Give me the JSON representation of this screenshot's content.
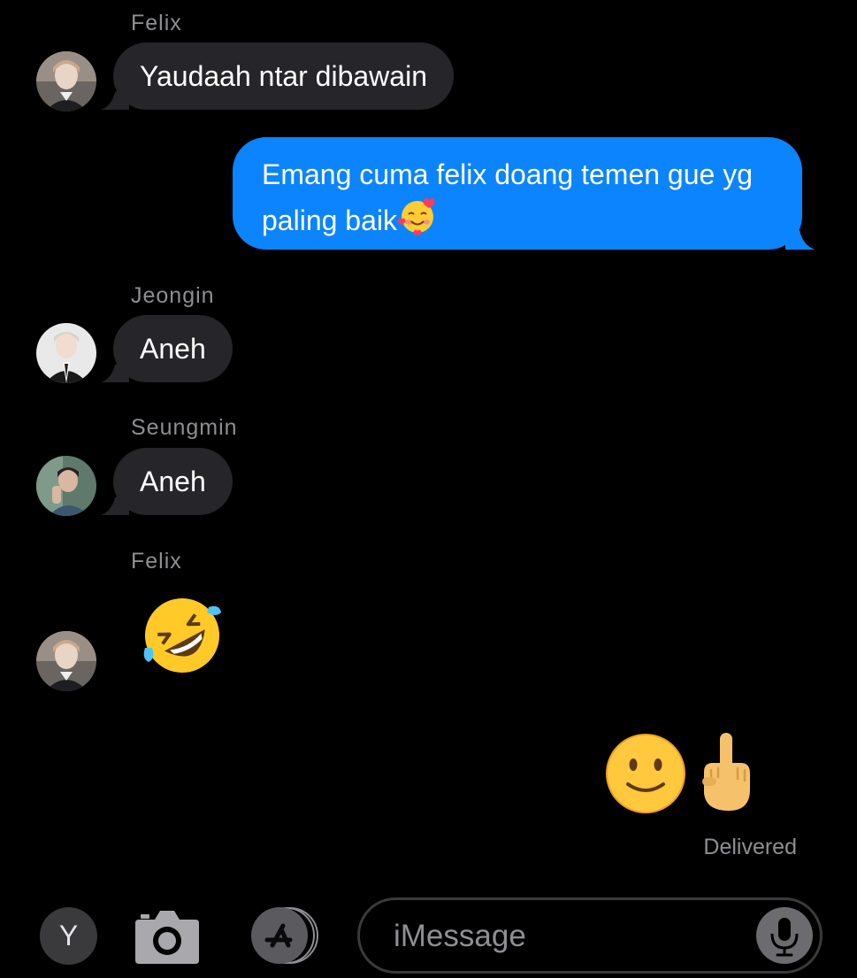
{
  "messages": [
    {
      "type": "incoming",
      "sender": "Felix",
      "text": "Yaudaah ntar dibawain"
    },
    {
      "type": "outgoing",
      "line1": "Emang cuma felix doang temen gue yg",
      "line2": "paling baik",
      "emoji": "smiling-face-with-hearts"
    },
    {
      "type": "incoming",
      "sender": "Jeongin",
      "text": "Aneh"
    },
    {
      "type": "incoming",
      "sender": "Seungmin",
      "text": "Aneh"
    },
    {
      "type": "incoming",
      "sender": "Felix",
      "emoji": "rolling-on-floor-laughing"
    },
    {
      "type": "outgoing",
      "emojis": [
        "slightly-smiling-face",
        "middle-finger"
      ]
    }
  ],
  "status": {
    "delivered": "Delivered"
  },
  "compose": {
    "apps_button_letter": "Y",
    "placeholder": "iMessage"
  },
  "colors": {
    "background": "#000000",
    "incoming_bubble": "#26252a",
    "outgoing_bubble": "#0b84fe",
    "secondary_text": "#8e8e93"
  }
}
